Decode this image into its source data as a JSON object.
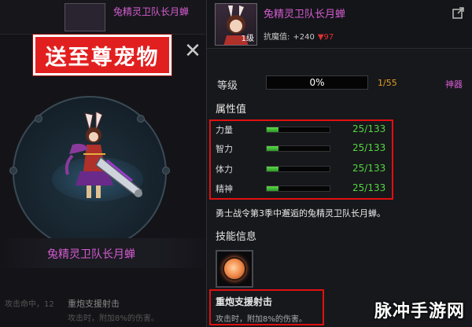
{
  "background": {
    "title": "兔精灵卫队长月蝉",
    "left_text": "攻击命中，12",
    "skill_name": "重炮支援射击",
    "skill_desc": "攻击时，附加8%的伤害。"
  },
  "banner": {
    "text": "送至尊宠物"
  },
  "pet": {
    "name": "兔精灵卫队长月蝉"
  },
  "header": {
    "title": "兔精灵卫队长月蝉",
    "level_badge": "1级",
    "resist_label": "抗魔值:",
    "resist_up": "+240",
    "resist_down": "▼97"
  },
  "level": {
    "label": "等级",
    "percent": "0%",
    "progress": 0,
    "count": "1/55",
    "tag": "神器"
  },
  "attributes": {
    "title": "属性值",
    "items": [
      {
        "label": "力量",
        "value": "25/133",
        "ratio": 0.188
      },
      {
        "label": "智力",
        "value": "25/133",
        "ratio": 0.188
      },
      {
        "label": "体力",
        "value": "25/133",
        "ratio": 0.188
      },
      {
        "label": "精神",
        "value": "25/133",
        "ratio": 0.188
      }
    ]
  },
  "description": "勇士战令第3季中邂逅的兔精灵卫队长月蝉。",
  "skills": {
    "title": "技能信息",
    "name": "重炮支援射击",
    "desc": "攻击时，附加8%的伤害。"
  },
  "watermark": "脉冲手游网",
  "colors": {
    "accent_purple": "#d45cd0",
    "highlight_red": "#e01010",
    "bar_green": "#55d640",
    "count_orange": "#e0a020"
  }
}
